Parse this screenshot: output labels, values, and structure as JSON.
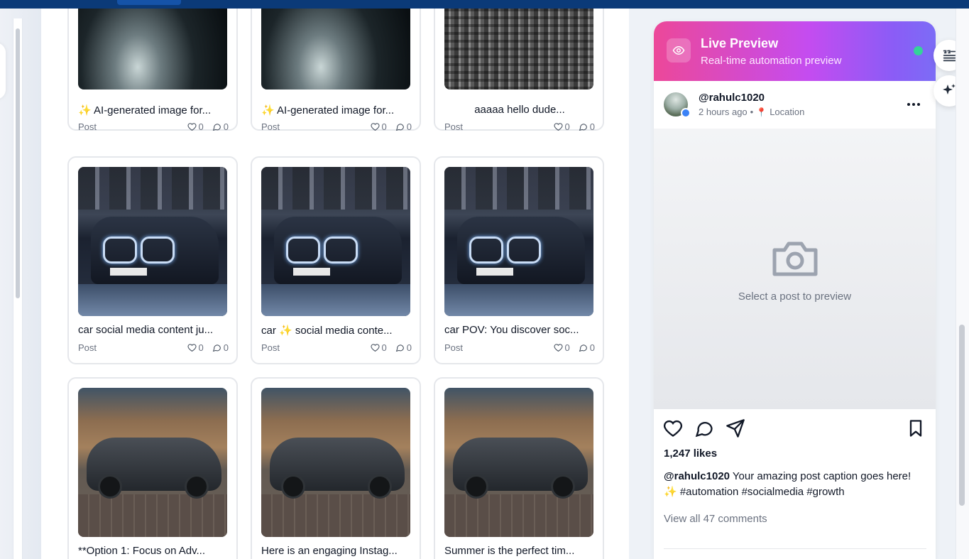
{
  "posts": [
    {
      "caption": "✨ AI-generated image for...",
      "type": "Post",
      "likes": "0",
      "comments": "0",
      "image": "supercar"
    },
    {
      "caption": "✨ AI-generated image for...",
      "type": "Post",
      "likes": "0",
      "comments": "0",
      "image": "supercar"
    },
    {
      "caption": "aaaaa hello dude...",
      "type": "Post",
      "likes": "0",
      "comments": "0",
      "image": "building"
    },
    {
      "caption": "car social media content ju...",
      "type": "Post",
      "likes": "0",
      "comments": "0",
      "image": "bmw-garage"
    },
    {
      "caption": "car ✨ social media conte...",
      "type": "Post",
      "likes": "0",
      "comments": "0",
      "image": "bmw-garage"
    },
    {
      "caption": "car POV: You discover soc...",
      "type": "Post",
      "likes": "0",
      "comments": "0",
      "image": "bmw-garage"
    },
    {
      "caption": "**Option 1: Focus on Adv...",
      "type": "",
      "likes": "",
      "comments": "",
      "image": "sedan"
    },
    {
      "caption": "Here is an engaging Instag...",
      "type": "",
      "likes": "",
      "comments": "",
      "image": "sedan"
    },
    {
      "caption": "Summer is the perfect tim...",
      "type": "",
      "likes": "",
      "comments": "",
      "image": "sedan"
    }
  ],
  "preview": {
    "title": "Live Preview",
    "subtitle": "Real-time automation preview",
    "status_color": "#34d399",
    "username": "@rahulc1020",
    "time": "2 hours ago",
    "separator": "•",
    "location": "Location",
    "empty_message": "Select a post to preview",
    "likes": "1,247 likes",
    "caption_user": "@rahulc1020",
    "caption_text": " Your amazing post caption goes here! ✨ #automation #socialmedia #growth",
    "view_comments": "View all 47 comments"
  },
  "side_tools": [
    {
      "icon": "quote-list-icon"
    },
    {
      "icon": "sparkles-icon"
    }
  ],
  "colors": {
    "topbar": "#0b3a78",
    "preview_gradient_start": "#ec4899",
    "preview_gradient_end": "#7c6cf6"
  }
}
